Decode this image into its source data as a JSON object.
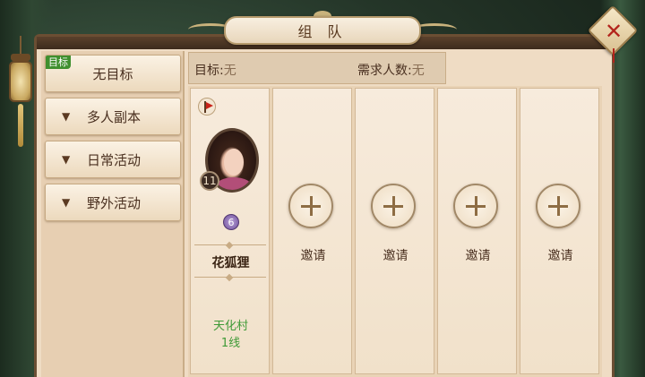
{
  "window": {
    "title": "组 队",
    "close_glyph": "✕"
  },
  "sidebar": {
    "target_tag": "目标",
    "items": [
      {
        "label": "无目标",
        "selected": true
      },
      {
        "label": "多人副本",
        "icon": "chevron-down-icon"
      },
      {
        "label": "日常活动",
        "icon": "chevron-down-icon"
      },
      {
        "label": "野外活动",
        "icon": "chevron-down-icon"
      }
    ],
    "chevron_glyph": "▼"
  },
  "info": {
    "target_label": "目标:",
    "target_value": "无",
    "need_label": "需求人数:",
    "need_value": "无"
  },
  "member": {
    "level": "11",
    "class_glyph": "6",
    "name": "花狐狸",
    "location": "天化村",
    "line": "1线",
    "flag_icon": "leader-flag-icon"
  },
  "slots": {
    "invite_label": "邀请",
    "count": 4
  },
  "colors": {
    "panel": "#efdcc4",
    "frame": "#6b4e33",
    "location_green": "#3f9a37",
    "tag_green": "#3f8f2e",
    "close_red": "#b3241c"
  }
}
